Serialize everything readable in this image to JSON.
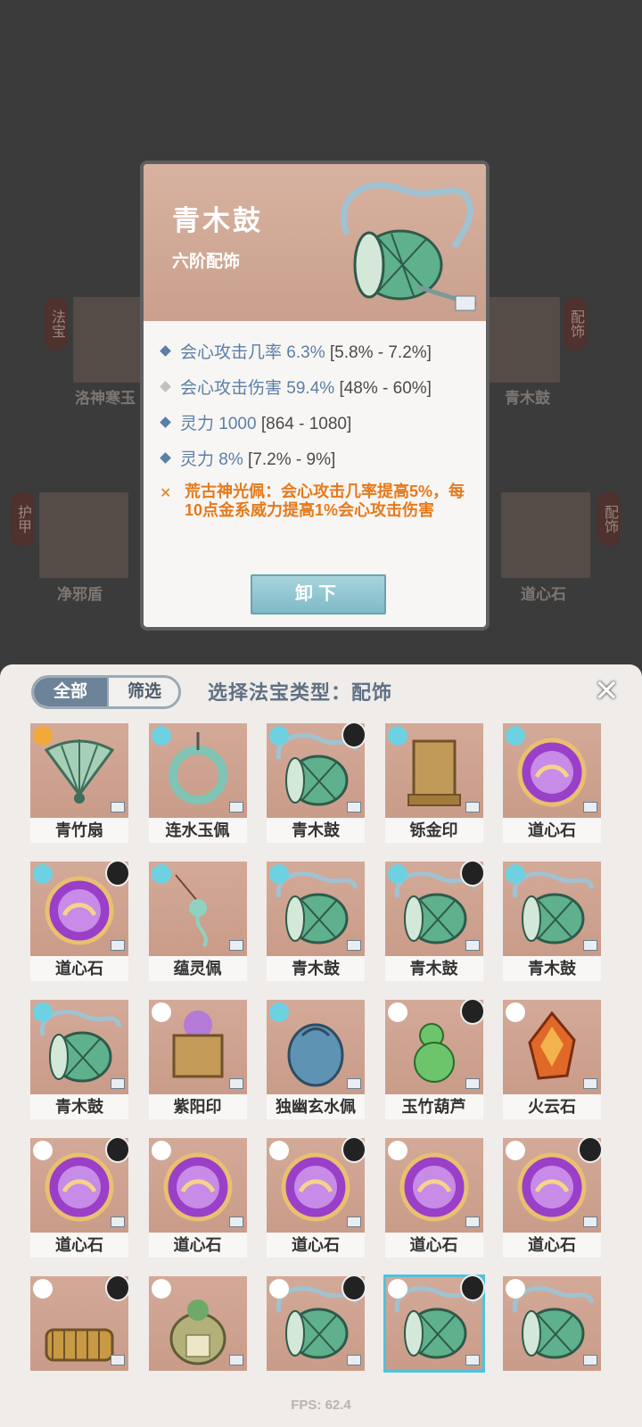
{
  "background": {
    "slots": [
      {
        "tag": "法宝",
        "label": "洛神寒玉"
      },
      {
        "tag": "配饰",
        "label": "青木鼓"
      },
      {
        "tag": "护甲",
        "label": "净邪盾"
      },
      {
        "tag": "配饰",
        "label": "道心石"
      }
    ]
  },
  "card": {
    "title": "青木鼓",
    "subtitle": "六阶配饰",
    "stats": [
      {
        "name": "会心攻击几率",
        "value": "6.3%",
        "range": "[5.8% - 7.2%]",
        "diamond_color": "#5b7fa6"
      },
      {
        "name": "会心攻击伤害",
        "value": "59.4%",
        "range": "[48% - 60%]",
        "diamond_color": "#c0c0c0"
      },
      {
        "name": "灵力",
        "value": "1000",
        "range": "[864 - 1080]",
        "diamond_color": "#5b7fa6"
      },
      {
        "name": "灵力",
        "value": "8%",
        "range": "[7.2% - 9%]",
        "diamond_color": "#5b7fa6"
      }
    ],
    "special": "荒古神光佩：会心攻击几率提高5%，每10点金系威力提高1%会心攻击伤害",
    "unequip_label": "卸下"
  },
  "panel": {
    "tab_all": "全部",
    "tab_filter": "筛选",
    "title": "选择法宝类型：配饰",
    "close_icon": "close-icon",
    "items": [
      {
        "name": "青竹扇",
        "art": "fan"
      },
      {
        "name": "连水玉佩",
        "art": "ring"
      },
      {
        "name": "青木鼓",
        "art": "drum",
        "avatar": true
      },
      {
        "name": "铄金印",
        "art": "seal"
      },
      {
        "name": "道心石",
        "art": "orb"
      },
      {
        "name": "道心石",
        "art": "orb",
        "avatar": true
      },
      {
        "name": "蕴灵佩",
        "art": "pendant"
      },
      {
        "name": "青木鼓",
        "art": "drum"
      },
      {
        "name": "青木鼓",
        "art": "drum",
        "avatar": true
      },
      {
        "name": "青木鼓",
        "art": "drum"
      },
      {
        "name": "青木鼓",
        "art": "drum"
      },
      {
        "name": "紫阳印",
        "art": "box"
      },
      {
        "name": "独幽玄水佩",
        "art": "jade"
      },
      {
        "name": "玉竹葫芦",
        "art": "gourd",
        "avatar": true
      },
      {
        "name": "火云石",
        "art": "fire"
      },
      {
        "name": "道心石",
        "art": "orb",
        "avatar": true
      },
      {
        "name": "道心石",
        "art": "orb"
      },
      {
        "name": "道心石",
        "art": "orb",
        "avatar": true
      },
      {
        "name": "道心石",
        "art": "orb"
      },
      {
        "name": "道心石",
        "art": "orb",
        "avatar": true
      },
      {
        "name": "",
        "art": "coil",
        "avatar": true
      },
      {
        "name": "",
        "art": "bag"
      },
      {
        "name": "",
        "art": "drum",
        "avatar": true
      },
      {
        "name": "",
        "art": "drum",
        "avatar": true,
        "selected": true
      },
      {
        "name": "",
        "art": "drum"
      }
    ]
  },
  "fps": "FPS: 62.4"
}
